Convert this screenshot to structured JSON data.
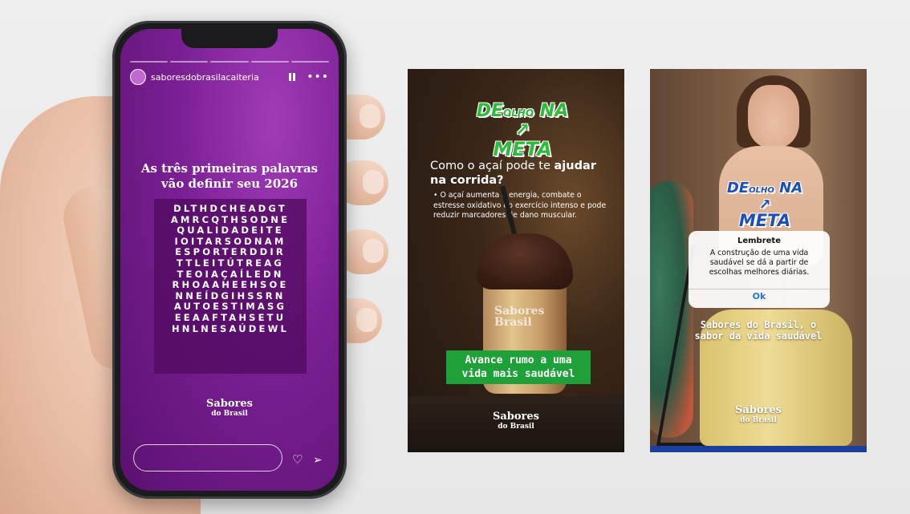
{
  "story": {
    "username": "saboresdobrasilacaiteria",
    "title_line1": "As três primeiras palavras",
    "title_line2": "vão definir seu 2026",
    "grid_rows": [
      "DLTHDCHEADGT",
      "AMRCQTHSODNE",
      "QUALIDADEITE",
      "IOITARSODNAM",
      "ESPORTERDDIR",
      "TTLEITÚTREAG",
      "TEOIAÇAÍLEDN",
      "RHOAAHEEHSOE",
      "NNEÍDGIHSSRN",
      "AUTOESTIMASG",
      "EEAAFTAHSETU",
      "HNLNESAÚDEWL"
    ],
    "brand_main": "Sabores",
    "brand_sub": "do Brasil"
  },
  "poster1": {
    "logo_line1_a": "DE",
    "logo_line1_b": "OLHO",
    "logo_line1_c": "NA",
    "logo_line2": "META",
    "question_a": "Como o açaí pode te ",
    "question_b": "ajudar",
    "question_c": "na corrida?",
    "body": "• O açaí aumenta a energia, combate o estresse oxidativo do exercício intenso e pode reduzir marcadores de dano muscular.",
    "cup_brand_1": "Sabores",
    "cup_brand_2": "Brasil",
    "cta_line1": "Avance rumo a uma",
    "cta_line2": "vida mais saudável",
    "brand_main": "Sabores",
    "brand_sub": "do Brasil"
  },
  "poster2": {
    "logo_line1_a": "DE",
    "logo_line1_b": "OLHO",
    "logo_line1_c": "NA",
    "logo_line2": "META",
    "dialog_title": "Lembrete",
    "dialog_text": "A construção de uma vida saudável se dá a partir de escolhas melhores diárias.",
    "dialog_ok": "Ok",
    "tagline_line1": "Sabores do Brasil, o",
    "tagline_line2": "sabor da vida saudável",
    "brand_main": "Sabores",
    "brand_sub": "do Brasil"
  },
  "colors": {
    "story_purple": "#7a1f93",
    "green_cta": "#1fa13a",
    "blue_logo": "#1c4fb5",
    "ios_link": "#2a72d6"
  },
  "icons": [
    "pause-icon",
    "more-icon",
    "heart-icon",
    "send-icon"
  ]
}
